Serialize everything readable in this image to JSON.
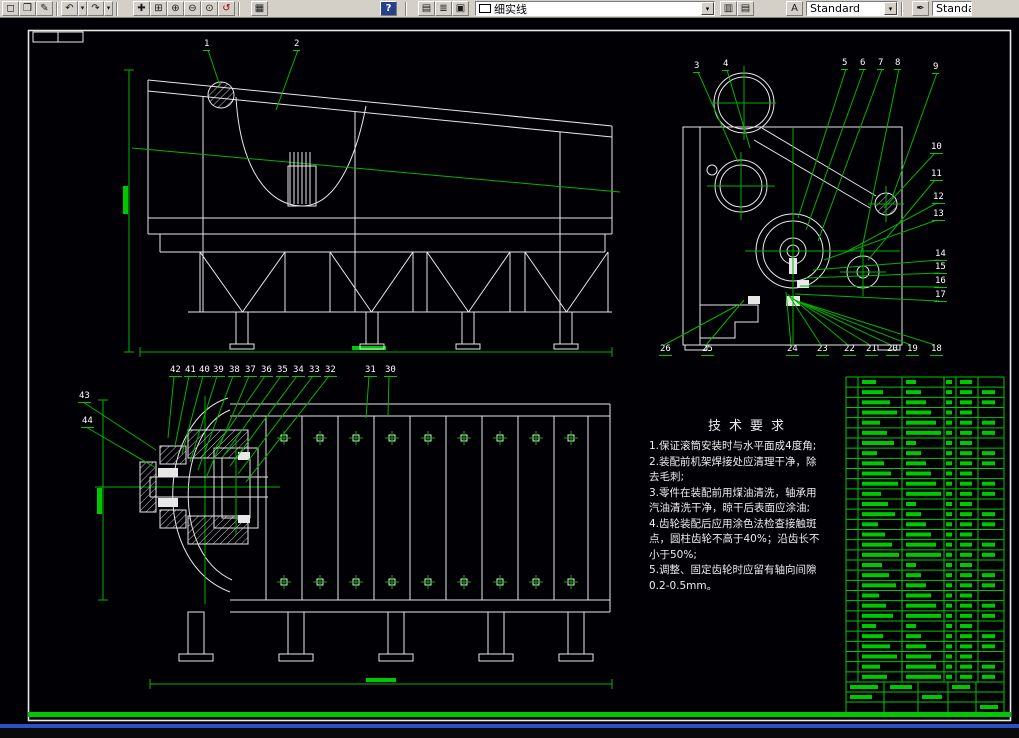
{
  "toolbar": {
    "caret_glyph": "▾",
    "linetype_combo_value": "细实线",
    "text_style_combo_value": "Standard",
    "dim_style_combo_value": "Standard",
    "icons": [
      {
        "name": "new-icon",
        "glyph": "◻"
      },
      {
        "name": "open-icon",
        "glyph": "❒"
      },
      {
        "name": "edit-icon",
        "glyph": "✎"
      },
      {
        "name": "undo-icon",
        "glyph": "↶"
      },
      {
        "name": "undo-options-icon",
        "glyph": "▾"
      },
      {
        "name": "redo-icon",
        "glyph": "↷"
      },
      {
        "name": "redo-options-icon",
        "glyph": "▾"
      },
      {
        "name": "pan-icon",
        "glyph": "✚"
      },
      {
        "name": "zoom-window-icon",
        "glyph": "⊞"
      },
      {
        "name": "zoom-in-icon",
        "glyph": "⊕"
      },
      {
        "name": "zoom-out-icon",
        "glyph": "⊖"
      },
      {
        "name": "zoom-realtime-icon",
        "glyph": "⊙"
      },
      {
        "name": "zoom-previous-icon",
        "glyph": "↺"
      },
      {
        "name": "table-icon",
        "glyph": "▦"
      },
      {
        "name": "help-icon",
        "glyph": "?"
      },
      {
        "name": "render-icon",
        "glyph": "▤"
      },
      {
        "name": "layers-icon",
        "glyph": "≣"
      },
      {
        "name": "color-swatch-icon",
        "glyph": "▣"
      },
      {
        "name": "layer-manager-icon",
        "glyph": "▥"
      },
      {
        "name": "properties-icon",
        "glyph": "▤"
      },
      {
        "name": "text-style-icon",
        "glyph": "A"
      },
      {
        "name": "dim-style-icon",
        "glyph": "✒"
      }
    ]
  },
  "drawing": {
    "tech_requirements": {
      "title": "技术要求",
      "lines": [
        "1.保证滚筒安装时与水平面成4度角;",
        "2.装配前机架焊接处应清理干净，除",
        "去毛刺;",
        "3.零件在装配前用煤油清洗，轴承用",
        "汽油清洗干净，晾干后表面应涂油;",
        "4.齿轮装配后应用涂色法检查接触斑",
        "点，圆柱齿轮不高于40%；沿齿长不",
        "小于50%;",
        "5.调整、固定齿轮时应留有轴向间隙",
        "0.2-0.5mm。"
      ]
    },
    "callouts": {
      "side_view": [
        "1",
        "2"
      ],
      "end_view": [
        "3",
        "4",
        "5",
        "6",
        "7",
        "8",
        "9",
        "10",
        "11",
        "12",
        "13",
        "14",
        "15",
        "16",
        "17",
        "18",
        "19",
        "20",
        "21",
        "22",
        "23",
        "24",
        "25",
        "26"
      ],
      "section_view": [
        "30",
        "31",
        "32",
        "33",
        "34",
        "35",
        "36",
        "37",
        "38",
        "39",
        "40",
        "41",
        "42",
        "43",
        "44"
      ]
    }
  }
}
